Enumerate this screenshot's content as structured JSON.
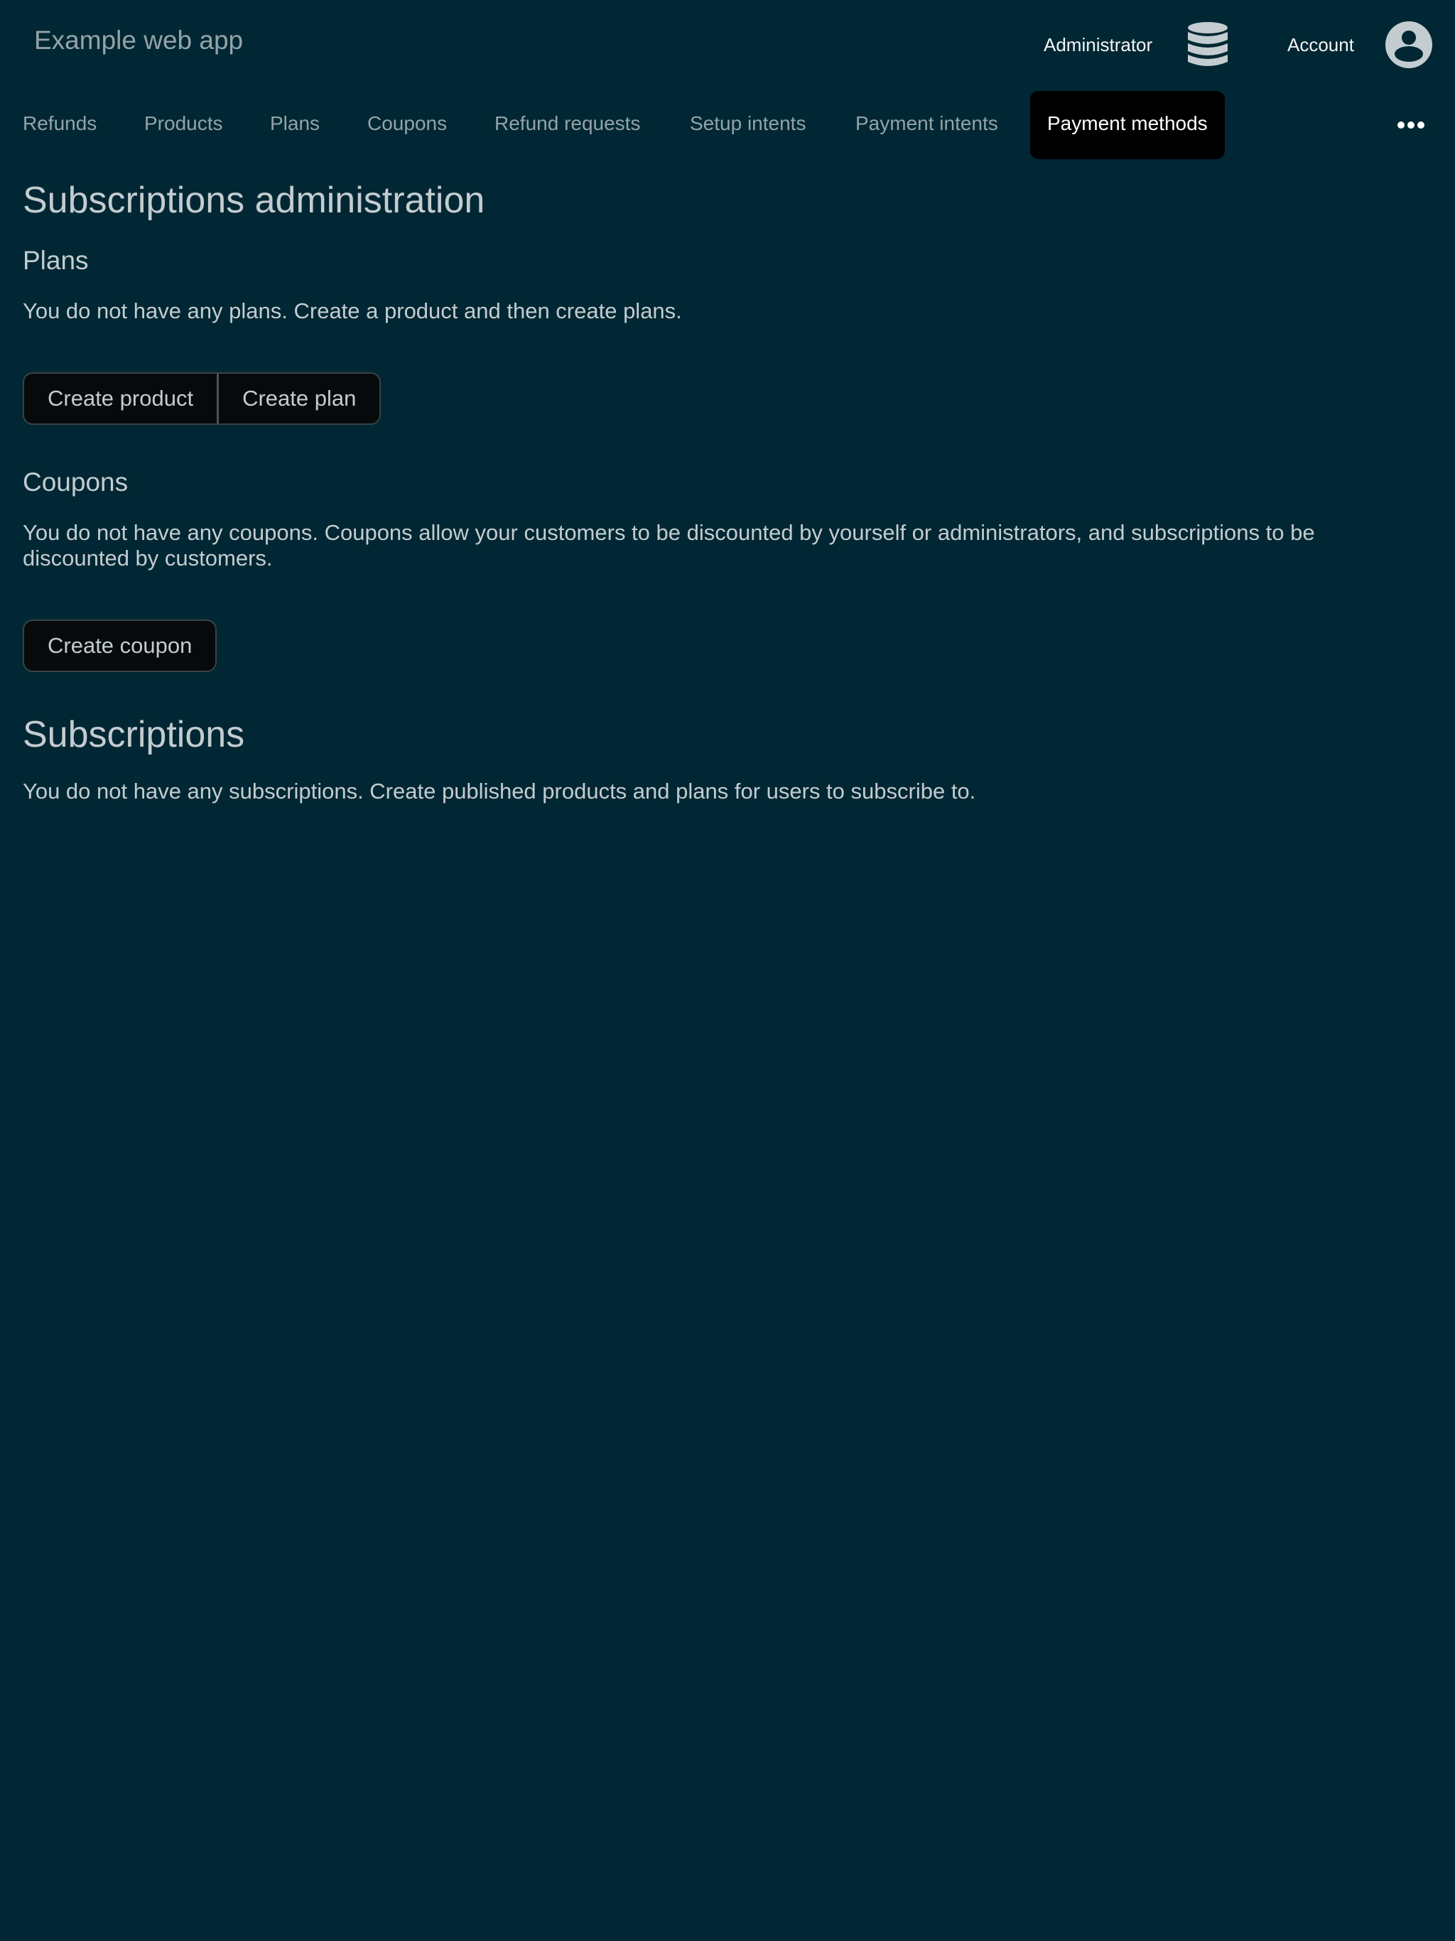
{
  "header": {
    "app_title": "Example web app",
    "admin_label": "Administrator",
    "admin_icon": "database-icon",
    "account_label": "Account",
    "account_icon": "user-circle-icon"
  },
  "nav": {
    "items": [
      {
        "label": "Refunds"
      },
      {
        "label": "Products"
      },
      {
        "label": "Plans"
      },
      {
        "label": "Coupons"
      },
      {
        "label": "Refund requests"
      },
      {
        "label": "Setup intents"
      },
      {
        "label": "Payment intents"
      },
      {
        "label": "Payment methods",
        "active": true
      }
    ],
    "more_icon": "more-horizontal-icon"
  },
  "main": {
    "title": "Subscriptions administration",
    "plans": {
      "heading": "Plans",
      "message": "You do not have any plans. Create a product and then create plans.",
      "create_product_label": "Create product",
      "create_plan_label": "Create plan"
    },
    "coupons": {
      "heading": "Coupons",
      "message": "You do not have any coupons. Coupons allow your customers to be discounted by yourself or administrators, and subscriptions to be discounted by customers.",
      "create_coupon_label": "Create coupon"
    },
    "subscriptions": {
      "heading": "Subscriptions",
      "message": "You do not have any subscriptions. Create published products and plans for users to subscribe to."
    }
  },
  "colors": {
    "background": "#002733",
    "text": "#c3ccd0",
    "muted": "#93a3a8",
    "active_tab_bg": "#000000",
    "button_bg": "#070a0b"
  }
}
